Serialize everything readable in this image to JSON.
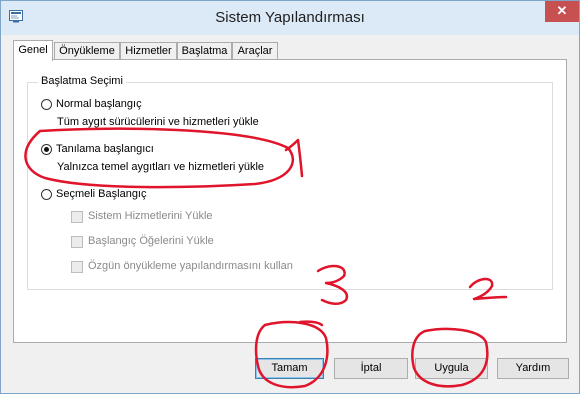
{
  "window": {
    "title": "Sistem Yapılandırması",
    "close_glyph": "✕",
    "icon": "msconfig-icon"
  },
  "tabs": [
    {
      "label": "Genel",
      "active": true
    },
    {
      "label": "Önyükleme",
      "active": false
    },
    {
      "label": "Hizmetler",
      "active": false
    },
    {
      "label": "Başlatma",
      "active": false
    },
    {
      "label": "Araçlar",
      "active": false
    }
  ],
  "startup_selection": {
    "group_label": "Başlatma Seçimi",
    "normal": {
      "label": "Normal başlangıç",
      "description": "Tüm aygıt sürücülerini ve hizmetleri yükle",
      "checked": false
    },
    "diagnostic": {
      "label": "Tanılama başlangıcı",
      "description": "Yalnızca temel aygıtları ve hizmetleri yükle",
      "checked": true
    },
    "selective": {
      "label": "Seçmeli Başlangıç",
      "checked": false,
      "options": [
        {
          "label": "Sistem Hizmetlerini Yükle",
          "checked": false,
          "enabled": false
        },
        {
          "label": "Başlangıç Öğelerini Yükle",
          "checked": false,
          "enabled": false
        },
        {
          "label": "Özgün önyükleme yapılandırmasını kullan",
          "checked": false,
          "enabled": false
        }
      ]
    }
  },
  "buttons": {
    "ok": "Tamam",
    "cancel": "İptal",
    "apply": "Uygula",
    "help": "Yardım"
  },
  "annotations": {
    "color": "#e0142a",
    "marks": [
      "1",
      "2",
      "3"
    ]
  }
}
